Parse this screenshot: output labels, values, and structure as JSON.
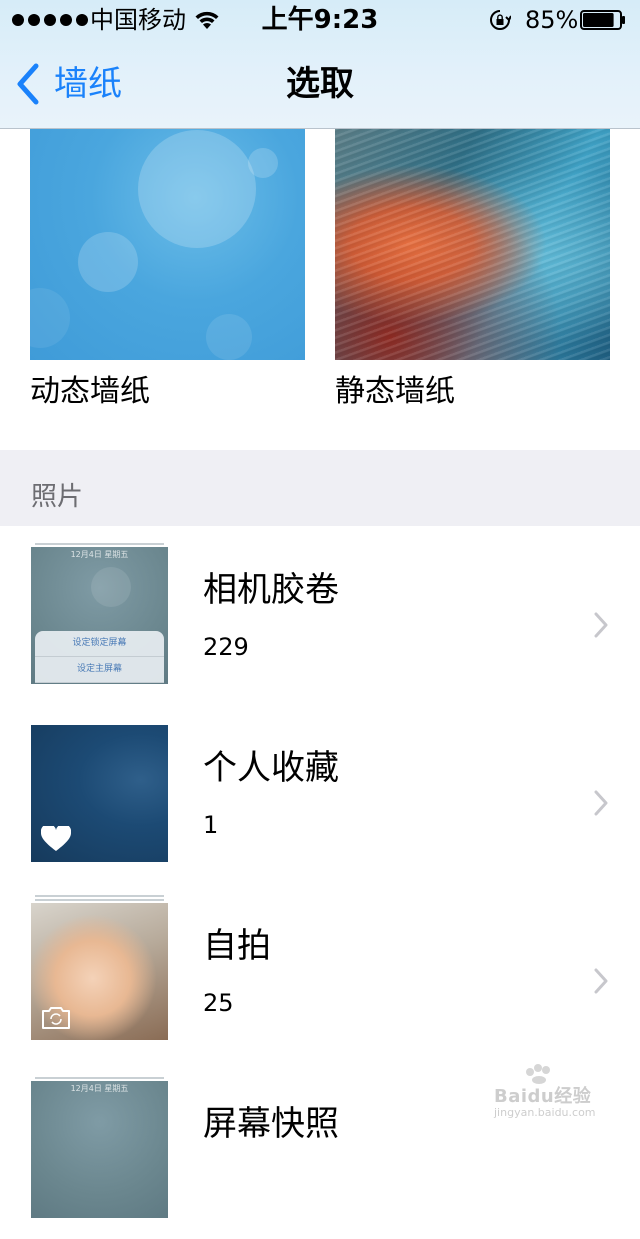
{
  "status_bar": {
    "carrier": "中国移动",
    "time": "上午9:23",
    "battery_percent": "85%",
    "battery_level": 0.85
  },
  "nav": {
    "back_label": "墙纸",
    "title": "选取"
  },
  "wallpapers": [
    {
      "label": "动态墙纸"
    },
    {
      "label": "静态墙纸"
    }
  ],
  "section": {
    "title": "照片"
  },
  "albums": [
    {
      "name": "相机胶卷",
      "count": "229",
      "thumb_texts": {
        "date": "12月4日 星期五",
        "menu_1": "设定锁定屏幕",
        "menu_2": "设定主屏幕"
      }
    },
    {
      "name": "个人收藏",
      "count": "1",
      "icon": "heart-icon"
    },
    {
      "name": "自拍",
      "count": "25",
      "icon": "camera-rotate-icon"
    },
    {
      "name": "屏幕快照",
      "count": "",
      "thumb_texts": {
        "date": "12月4日 星期五"
      }
    }
  ],
  "watermark": {
    "brand": "Baidu经验",
    "url": "jingyan.baidu.com"
  },
  "colors": {
    "accent": "#1a82fb",
    "section_bg": "#efeff4",
    "section_text": "#6d6d72",
    "chevron": "#c7c7cc"
  }
}
